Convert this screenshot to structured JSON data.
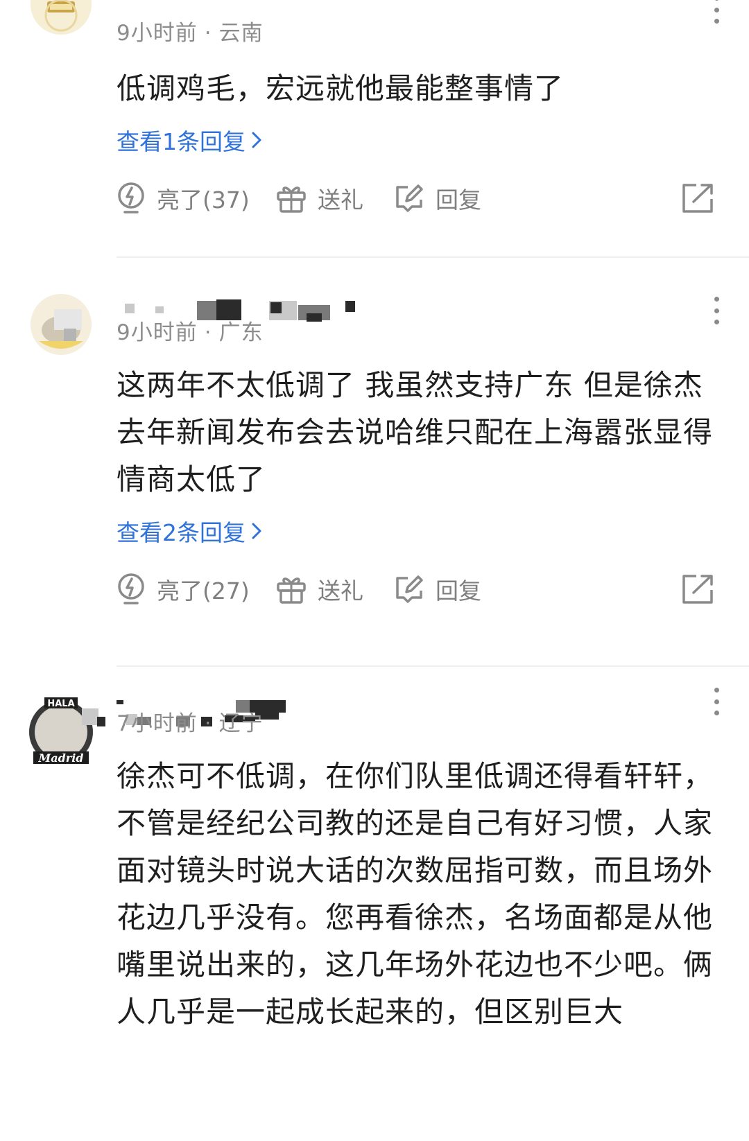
{
  "comments": [
    {
      "time": "9小时前",
      "location": "云南",
      "text": "低调鸡毛，宏远就他最能整事情了",
      "replies": "查看1条回复",
      "likes": "亮了(37)",
      "gift": "送礼",
      "reply": "回复"
    },
    {
      "time": "9小时前",
      "location": "广东",
      "text": "这两年不太低调了 我虽然支持广东 但是徐杰去年新闻发布会去说哈维只配在上海嚣张显得情商太低了",
      "replies": "查看2条回复",
      "likes": "亮了(27)",
      "gift": "送礼",
      "reply": "回复"
    },
    {
      "time": "7小时前",
      "location": "辽宁",
      "text": "徐杰可不低调，在你们队里低调还得看轩轩，不管是经纪公司教的还是自己有好习惯，人家面对镜头时说大话的次数屈指可数，而且场外花边几乎没有。您再看徐杰，名场面都是从他嘴里说出来的，这几年场外花边也不少吧。俩人几乎是一起成长起来的，但区别巨大",
      "avatar_text_top": "HALA",
      "avatar_text_bottom": "Madrid"
    }
  ],
  "separator": "·",
  "colors": {
    "link": "#2f72d8",
    "meta": "#8c8c8c",
    "text": "#1f1f1f",
    "action": "#7f7f7f"
  }
}
